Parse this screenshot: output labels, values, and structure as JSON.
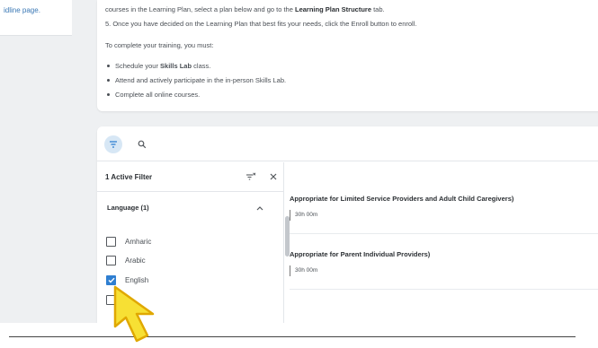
{
  "left_card": {
    "link_text": "idline page."
  },
  "instructions": {
    "line1_pre": "courses in the Learning Plan, select a plan below and go to the ",
    "line1_bold": "Learning Plan Structure",
    "line1_post": " tab.",
    "line2": "5. Once you have decided on the Learning Plan that best fits your needs, click the Enroll button to enroll.",
    "line3": "To complete your training, you must:",
    "bullet1_pre": "Schedule your ",
    "bullet1_bold": "Skills Lab",
    "bullet1_post": " class.",
    "bullet2": "Attend and actively participate in the in-person Skills Lab.",
    "bullet3": "Complete all online courses."
  },
  "toolbar": {
    "filter_icon": "filter-icon",
    "search_icon": "search-icon",
    "accent": "#d7e7f5"
  },
  "filter_panel": {
    "title": "1 Active Filter",
    "language_section": "Language (1)",
    "options": [
      {
        "label": "Amharic",
        "checked": false
      },
      {
        "label": "Arabic",
        "checked": false
      },
      {
        "label": "English",
        "checked": true
      },
      {
        "label": "",
        "checked": false
      }
    ]
  },
  "courses": [
    {
      "title": "Appropriate for Limited Service Providers and Adult Child Caregivers)",
      "duration": "30h 00m"
    },
    {
      "title": "Appropriate for Parent Individual Providers)",
      "duration": "30h 00m"
    }
  ],
  "colors": {
    "checkbox_checked": "#2f7fd1",
    "cursor_fill": "#f7e034"
  }
}
